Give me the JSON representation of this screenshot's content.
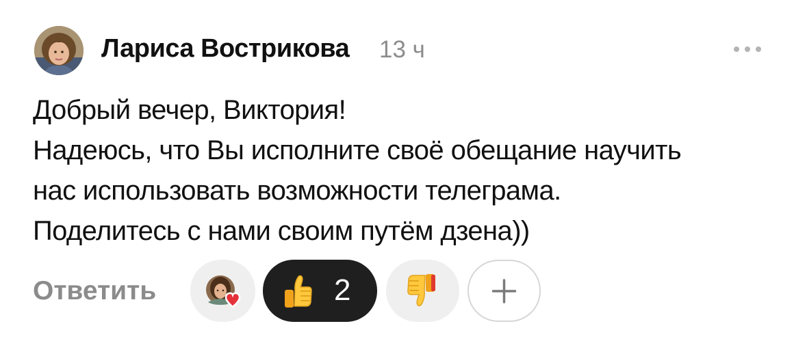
{
  "comment": {
    "author": "Лариса Вострикова",
    "time": "13 ч",
    "lines": [
      "Добрый вечер, Виктория!",
      "Надеюсь, что Вы исполните своё обещание научить",
      "нас использовать возможности телеграма.",
      "Поделитесь с нами своим путём дзена))"
    ]
  },
  "actions": {
    "reply_label": "Ответить",
    "like_count": "2"
  },
  "icons": {
    "avatar": "user-avatar-photo",
    "more": "more-dots-icon",
    "reacted": "reacted-avatar-with-heart-icon",
    "like": "thumbs-up-emoji-icon",
    "dislike": "thumbs-down-emoji-icon",
    "add": "plus-icon"
  },
  "colors": {
    "text": "#111111",
    "muted": "#8c8c8c",
    "pill_bg": "#efefef",
    "active_pill_bg": "#1f1f1f",
    "heart": "#e5313a",
    "emoji_yellow": "#ffc83d"
  }
}
